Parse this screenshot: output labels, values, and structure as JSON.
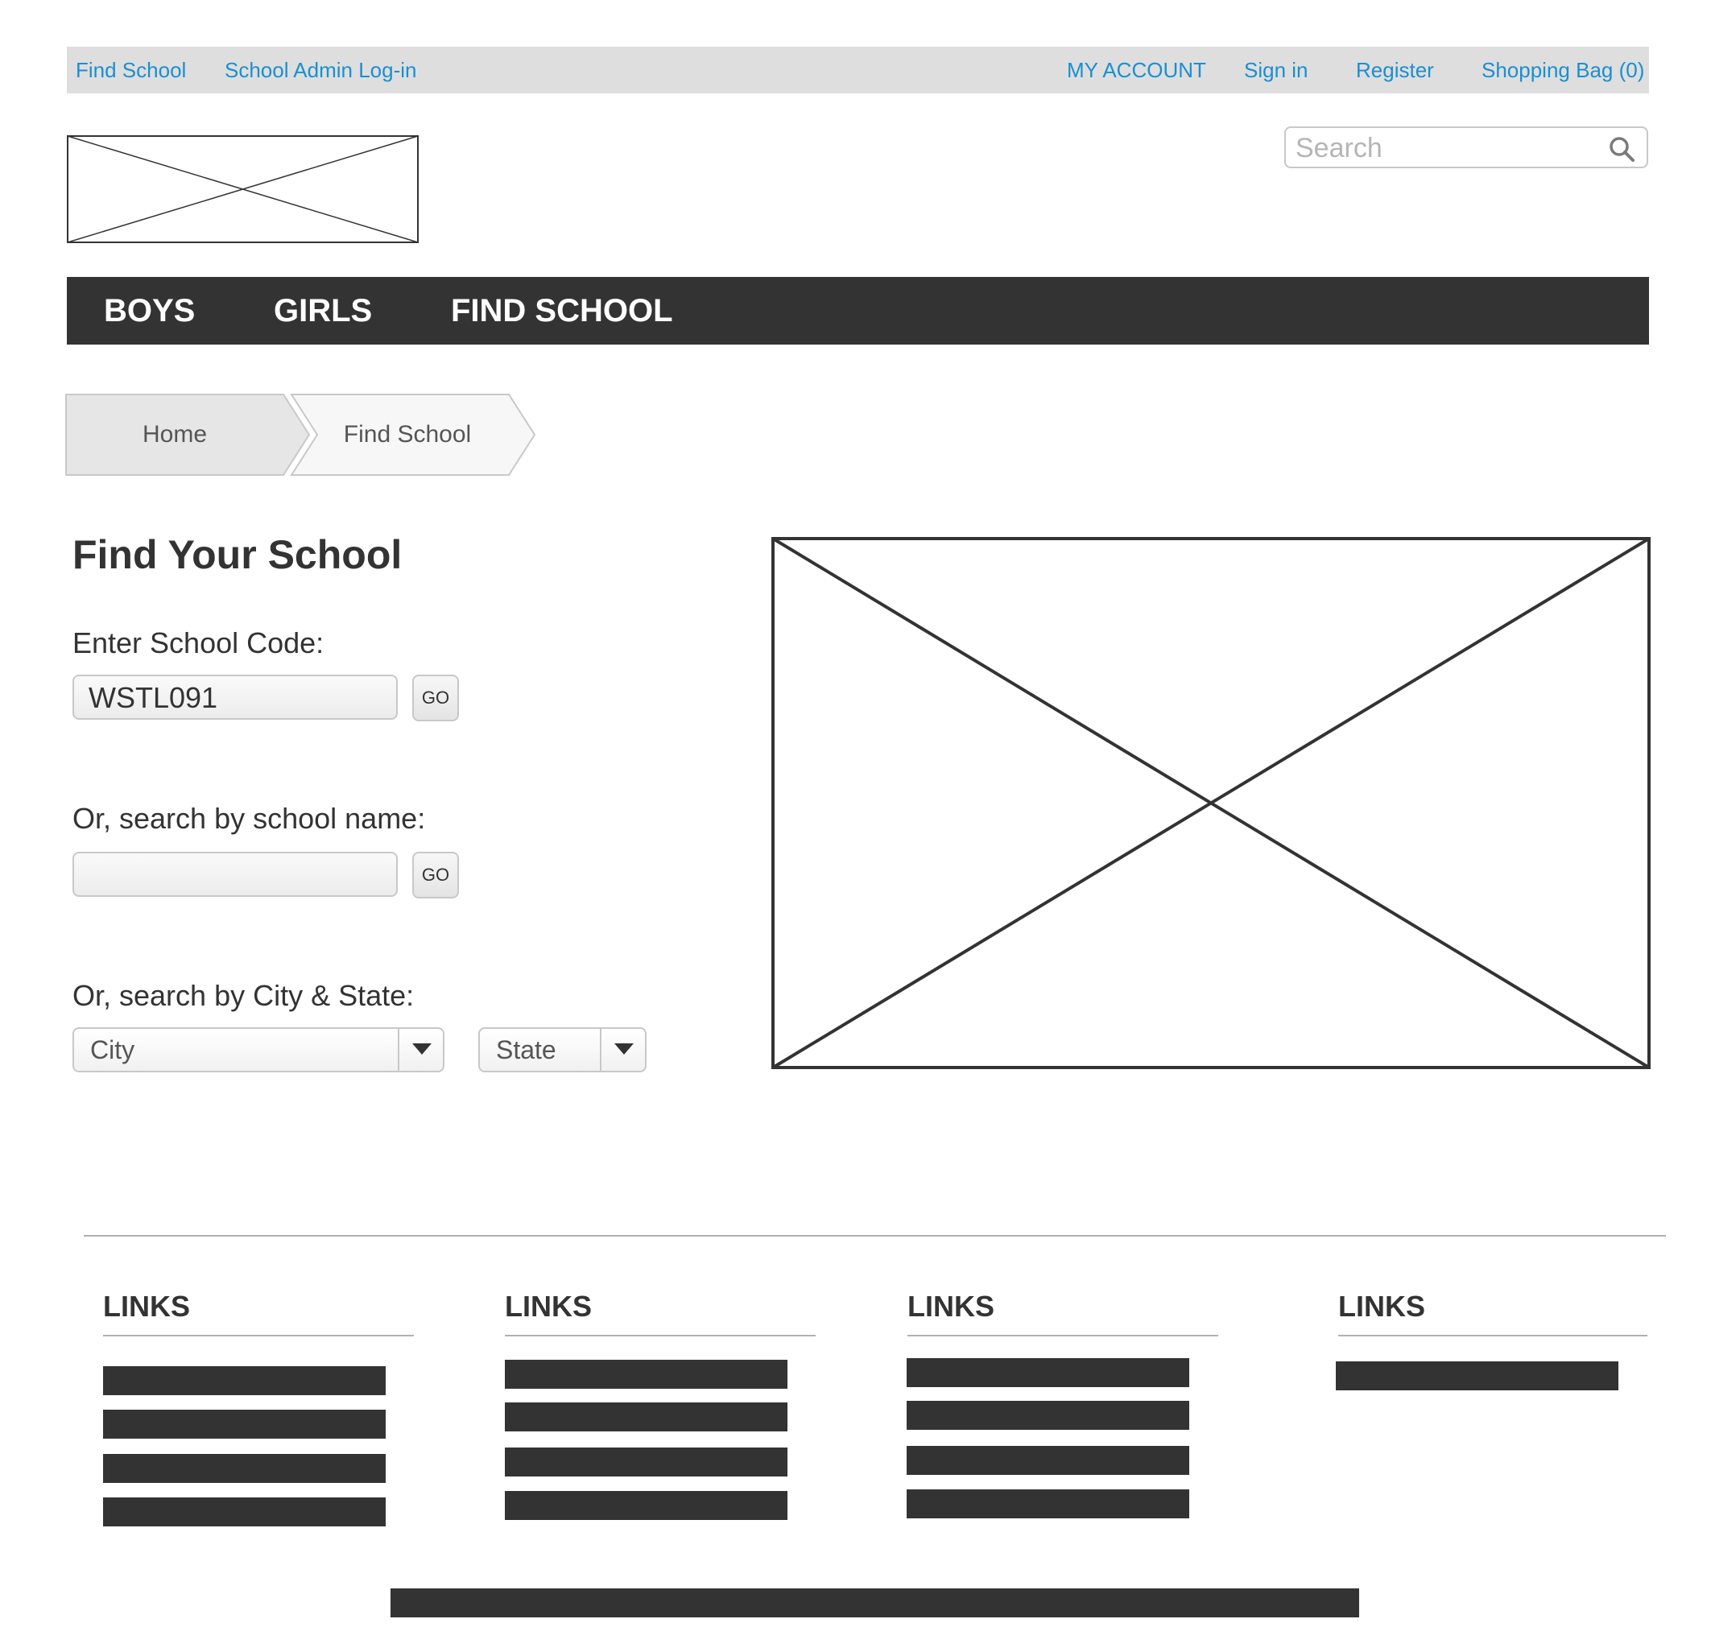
{
  "utility_bar": {
    "left_links": [
      "Find School",
      "School Admin Log-in"
    ],
    "right_links": [
      "MY ACCOUNT",
      "Sign in",
      "Register",
      "Shopping Bag (0)"
    ]
  },
  "search": {
    "placeholder": "Search",
    "icon": "search-icon"
  },
  "main_nav": {
    "items": [
      "BOYS",
      "GIRLS",
      "FIND SCHOOL"
    ]
  },
  "breadcrumb": {
    "items": [
      "Home",
      "Find School"
    ]
  },
  "form": {
    "heading": "Find Your School",
    "school_code_label": "Enter School Code:",
    "school_code_value": "WSTL091",
    "go_label": "GO",
    "school_name_label": "Or, search by school name:",
    "school_name_value": "",
    "city_state_label": "Or, search by City & State:",
    "city_value": "City",
    "state_value": "State"
  },
  "footer": {
    "columns": [
      {
        "heading": "LINKS",
        "link_count": 4
      },
      {
        "heading": "LINKS",
        "link_count": 4
      },
      {
        "heading": "LINKS",
        "link_count": 4
      },
      {
        "heading": "LINKS",
        "link_count": 1
      }
    ]
  },
  "colors": {
    "link_blue": "#1a8fd0",
    "nav_dark": "#333333",
    "utility_bar_gray": "#dedede"
  }
}
